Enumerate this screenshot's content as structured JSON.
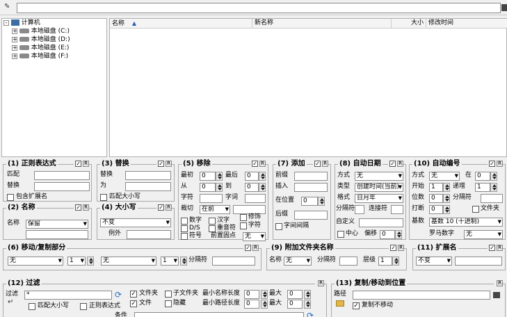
{
  "address": {
    "value": ""
  },
  "tree": {
    "items": [
      {
        "label": "计算机"
      },
      {
        "label": "本地磁盘 (C:)"
      },
      {
        "label": "本地磁盘 (D:)"
      },
      {
        "label": "本地磁盘 (E:)"
      },
      {
        "label": "本地磁盘 (F:)"
      }
    ]
  },
  "filelist": {
    "columns": [
      "名称",
      "新名称",
      "大小",
      "修改时间"
    ]
  },
  "regex": {
    "title": "(1) 正则表达式",
    "match": "匹配",
    "replace": "替换",
    "ext": "包含扩展名"
  },
  "name": {
    "title": "(2) 名称",
    "label": "名称",
    "value": "保留"
  },
  "repl": {
    "title": "(3) 替换",
    "replace": "替换",
    "to": "为",
    "case": "匹配大小写"
  },
  "casep": {
    "title": "(4) 大小写",
    "value": "不变",
    "except": "例外"
  },
  "remove": {
    "title": "(5) 移除",
    "first": "最初",
    "first_v": "0",
    "last": "最后",
    "last_v": "0",
    "from": "从",
    "from_v": "0",
    "to": "到",
    "to_v": "0",
    "chars": "字符",
    "words": "字词",
    "crop": "裁切",
    "crop_v": "在前",
    "digits": "数字",
    "sym": "D/S",
    "symbols": "符号",
    "chinese": "汉字",
    "dup": "重音符",
    "front": "前置固点",
    "trim": "修饰",
    "chars2": "字符",
    "none": "无"
  },
  "add": {
    "title": "(7) 添加",
    "prefix": "前缀",
    "insert": "插入",
    "at": "在位置",
    "at_v": "0",
    "suffix": "后缀",
    "wordsp": "字间间隔"
  },
  "autodate": {
    "title": "(8) 自动日期",
    "mode": "方式",
    "mode_v": "无",
    "type": "类型",
    "type_v": "创建时间(当前)",
    "format": "格式",
    "format_v": "日月年",
    "sep": "分隔符",
    "join": "连接符",
    "custom": "自定义",
    "center": "中心",
    "offset": "偏移",
    "offset_v": "0"
  },
  "autonum": {
    "title": "(10) 自动编号",
    "mode": "方式",
    "mode_v": "无",
    "at": "在",
    "at_v": "0",
    "start": "开始",
    "start_v": "1",
    "incr": "递增",
    "incr_v": "1",
    "digits": "位数",
    "digits_v": "0",
    "sep": "分隔符",
    "break": "打断",
    "break_v": "0",
    "folder": "文件夹",
    "base": "基数",
    "base_v": "基数 10 (十进制)",
    "roman": "罗马数字",
    "roman_v": "无"
  },
  "move": {
    "title": "(6) 移动/复制部分",
    "a": "无",
    "b": "1",
    "c": "无",
    "d": "1",
    "sep": "分隔符"
  },
  "addfolder": {
    "title": "(9) 附加文件夹名称",
    "name": "名称",
    "name_v": "无",
    "sep": "分隔符",
    "levels": "层级",
    "levels_v": "1"
  },
  "ext": {
    "title": "(11) 扩展名",
    "value": "不变"
  },
  "filter": {
    "title": "(12) 过滤",
    "filter": "过滤",
    "filter_v": "*",
    "folders": "文件夹",
    "subfolders": "子文件夹",
    "files": "文件",
    "hidden": "隐藏",
    "minname": "最小名称长度",
    "minname_v": "0",
    "maxname": "最大",
    "maxname_v": "0",
    "minpath": "最小路径长度",
    "minpath_v": "0",
    "maxpath": "最大",
    "maxpath_v": "0",
    "case": "匹配大小写",
    "regex": "正则表达式",
    "cond": "条件"
  },
  "copymove": {
    "title": "(13) 复制/移动到位置",
    "path": "路径",
    "nomove": "复制不移动"
  }
}
